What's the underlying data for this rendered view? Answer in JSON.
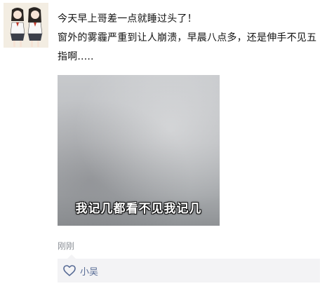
{
  "post": {
    "lines": [
      "今天早上哥差一点就睡过头了！",
      "窗外的雾霾严重到让人崩溃，早晨八点多，还是伸手不见五",
      "指啊....."
    ]
  },
  "photo": {
    "caption": "我记几都看不见我记几"
  },
  "meta": {
    "timestamp": "刚刚"
  },
  "likes": {
    "icon": "heart-icon",
    "names": "小吴"
  }
}
